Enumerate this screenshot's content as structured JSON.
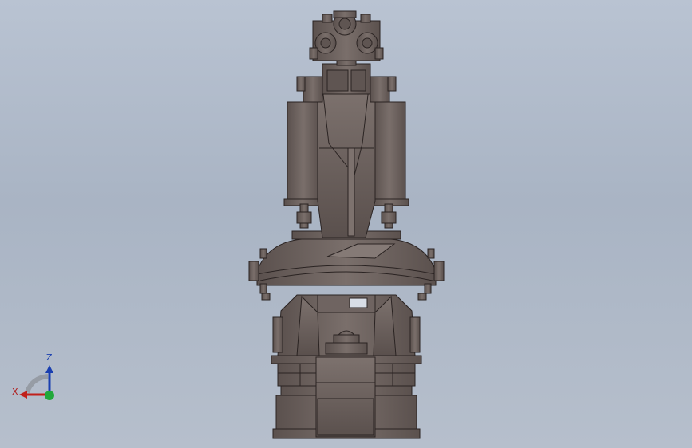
{
  "viewport": {
    "background_top": "#b9c3d2",
    "background_bottom": "#b6bfcc"
  },
  "model": {
    "name": "robot-arm-assembly",
    "body_color": "#6f6461",
    "edge_color": "#2a2322",
    "highlight_color": "#8a7f7b"
  },
  "triad": {
    "z_label": "Z",
    "x_label": "X",
    "z_color": "#1a3fb0",
    "x_color": "#c0201a",
    "y_color": "#22a83a"
  }
}
